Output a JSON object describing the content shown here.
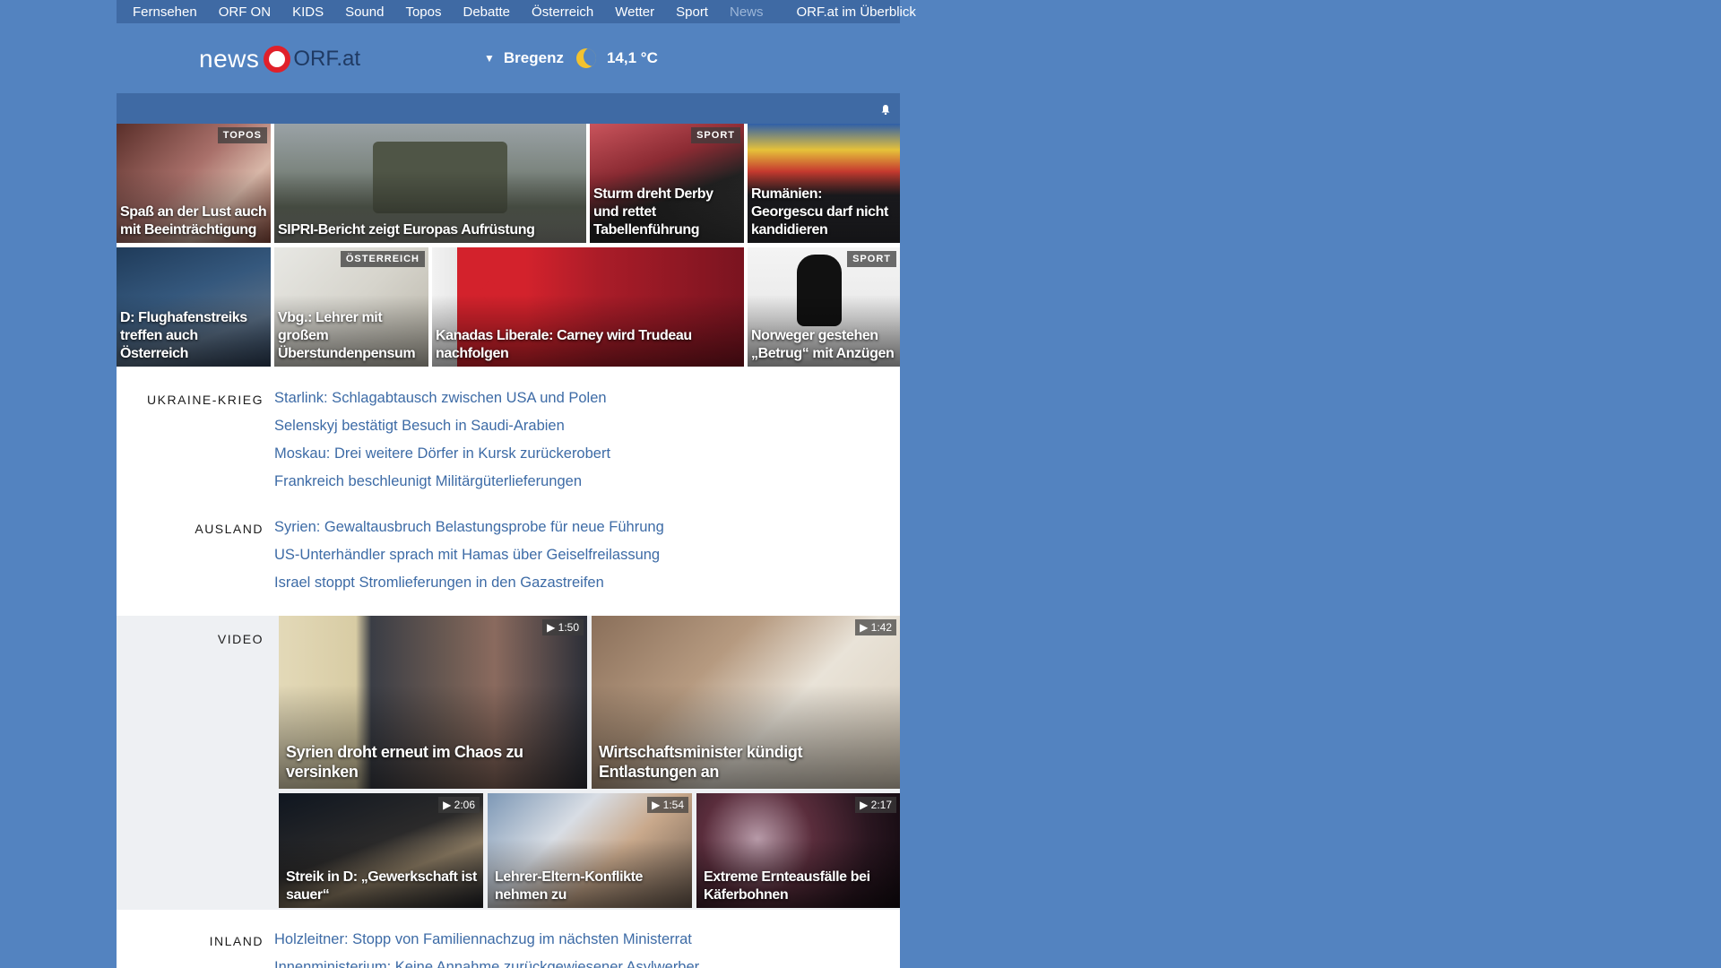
{
  "topnav": {
    "items": [
      "Fernsehen",
      "ORF ON",
      "KIDS",
      "Sound",
      "Topos",
      "Debatte",
      "Österreich",
      "Wetter",
      "Sport",
      "News"
    ],
    "active": "News",
    "overview": "ORF.at im Überblick"
  },
  "header": {
    "logo_news": "news",
    "logo_orf": "ORF.at",
    "weather": {
      "city": "Bregenz",
      "temp": "14,1 °C",
      "icon": "moon-icon"
    }
  },
  "toolbar": {
    "bell_icon": "bell-icon"
  },
  "teasers_row1": [
    {
      "caption": "Spaß an der Lust auch mit Beeinträchtigung",
      "badge": "TOPOS"
    },
    {
      "caption": "SIPRI-Bericht zeigt Europas Aufrüstung",
      "badge": ""
    },
    {
      "caption": "Sturm dreht Derby und rettet Tabellenführung",
      "badge": "SPORT"
    },
    {
      "caption": "Rumänien: Georgescu darf nicht kandidieren",
      "badge": ""
    }
  ],
  "teasers_row2": [
    {
      "caption": "D: Flughafenstreiks treffen auch Österreich",
      "badge": ""
    },
    {
      "caption": "Vbg.: Lehrer mit großem Überstundenpensum",
      "badge": "ÖSTERREICH"
    },
    {
      "caption": "Kanadas Liberale: Carney wird Trudeau nachfolgen",
      "badge": ""
    },
    {
      "caption": "Norweger gestehen „Betrug“ mit Anzügen",
      "badge": "SPORT"
    }
  ],
  "sections": {
    "ukraine": {
      "label": "UKRAINE-KRIEG",
      "headlines": [
        "Starlink: Schlagabtausch zwischen USA und Polen",
        "Selenskyj bestätigt Besuch in Saudi-Arabien",
        "Moskau: Drei weitere Dörfer in Kursk zurückerobert",
        "Frankreich beschleunigt Militärgüterlieferungen"
      ]
    },
    "ausland": {
      "label": "AUSLAND",
      "headlines": [
        "Syrien: Gewaltausbruch Belastungsprobe für neue Führung",
        "US-Unterhändler sprach mit Hamas über Geiselfreilassung",
        "Israel stoppt Stromlieferungen in den Gazastreifen"
      ]
    },
    "video": {
      "label": "VIDEO",
      "items": [
        {
          "caption": "Syrien droht erneut im Chaos zu versinken",
          "duration": "1:50"
        },
        {
          "caption": "Wirtschaftsminister kündigt Entlastungen an",
          "duration": "1:42"
        },
        {
          "caption": "Streik in D: „Gewerkschaft ist sauer“",
          "duration": "2:06"
        },
        {
          "caption": "Lehrer-Eltern-Konflikte nehmen zu",
          "duration": "1:54"
        },
        {
          "caption": "Extreme Ernteausfälle bei Käferbohnen",
          "duration": "2:17"
        }
      ]
    },
    "inland": {
      "label": "INLAND",
      "headlines": [
        "Holzleitner: Stopp von Familiennachzug im nächsten Ministerrat",
        "Innenministerium: Keine Annahme zurückgewiesener Asylwerber"
      ]
    }
  },
  "colors": {
    "page_bg": "#5383c0",
    "nav_bg": "#3f6aa4",
    "link": "#3d6ba6",
    "orf_red": "#e0202a"
  }
}
